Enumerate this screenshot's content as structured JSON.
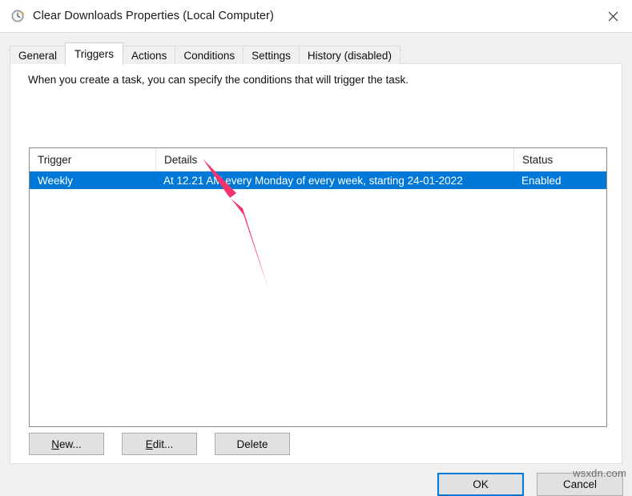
{
  "window": {
    "title": "Clear Downloads Properties (Local Computer)",
    "title_icon": "clock-schedule-icon",
    "close_icon": "close-icon"
  },
  "tabs": [
    {
      "label": "General",
      "active": false
    },
    {
      "label": "Triggers",
      "active": true
    },
    {
      "label": "Actions",
      "active": false
    },
    {
      "label": "Conditions",
      "active": false
    },
    {
      "label": "Settings",
      "active": false
    },
    {
      "label": "History (disabled)",
      "active": false
    }
  ],
  "content": {
    "intro_text": "When you create a task, you can specify the conditions that will trigger the task."
  },
  "triggers_list": {
    "columns": [
      "Trigger",
      "Details",
      "Status"
    ],
    "rows": [
      {
        "trigger": "Weekly",
        "details": "At 12.21 AM every Monday of every week, starting 24-01-2022",
        "status": "Enabled",
        "selected": true
      }
    ]
  },
  "action_buttons": {
    "new": {
      "prefix": "",
      "accel": "N",
      "suffix": "ew..."
    },
    "edit": {
      "prefix": "",
      "accel": "E",
      "suffix": "dit..."
    },
    "delete": {
      "label": "Delete"
    }
  },
  "footer_buttons": {
    "ok": "OK",
    "cancel": "Cancel"
  },
  "annotation": {
    "arrow_color": "#f5336a",
    "arrow_name": "pink-pointer-arrow"
  },
  "watermark": {
    "text": "wsxdn.com"
  },
  "colors": {
    "selection_blue": "#0078d7",
    "window_bg": "#f0f0f0",
    "content_bg": "#ffffff",
    "button_face": "#e1e1e1",
    "accent_pink": "#f5336a"
  }
}
